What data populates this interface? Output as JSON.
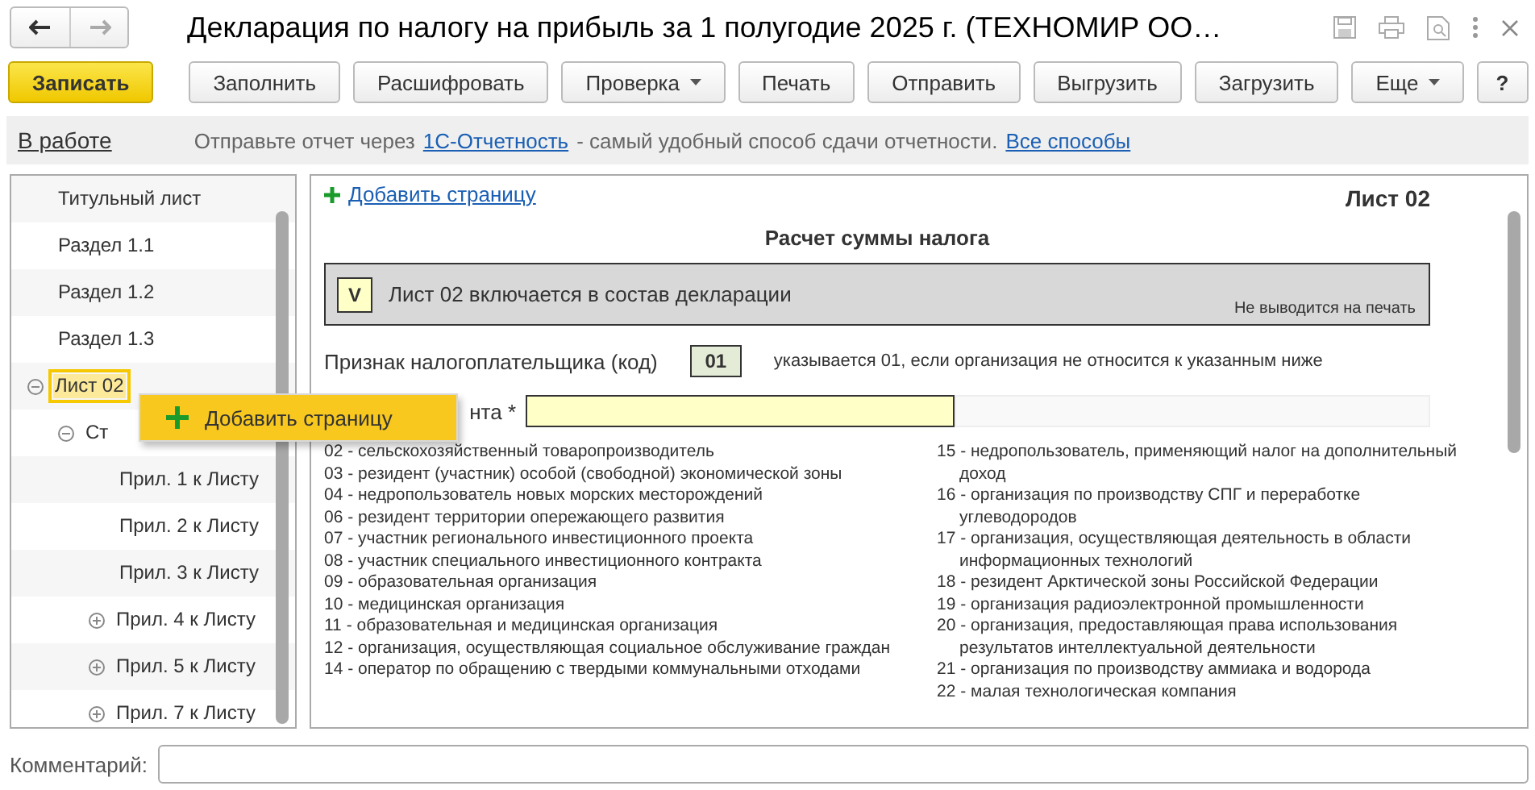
{
  "window": {
    "title": "Декларация по налогу на прибыль за 1 полугодие 2025 г. (ТЕХНОМИР ОО…"
  },
  "toolbar": [
    {
      "label": "Записать",
      "kind": "primary"
    },
    {
      "label": "Заполнить",
      "kind": "plain"
    },
    {
      "label": "Расшифровать",
      "kind": "plain"
    },
    {
      "label": "Проверка",
      "kind": "dropdown"
    },
    {
      "label": "Печать",
      "kind": "plain"
    },
    {
      "label": "Отправить",
      "kind": "plain"
    },
    {
      "label": "Выгрузить",
      "kind": "plain"
    },
    {
      "label": "Загрузить",
      "kind": "plain"
    },
    {
      "label": "Еще",
      "kind": "dropdown-right"
    },
    {
      "label": "?",
      "kind": "help"
    }
  ],
  "info_bar": {
    "status": "В работе",
    "text_before": "Отправьте отчет через",
    "link": "1С-Отчетность",
    "text_after": "- самый удобный способ сдачи отчетности.",
    "link_all": "Все способы"
  },
  "sidebar": {
    "items": [
      {
        "label": "Титульный лист",
        "selected": false
      },
      {
        "label": "Раздел 1.1",
        "selected": false
      },
      {
        "label": "Раздел 1.2",
        "selected": false
      },
      {
        "label": "Раздел 1.3",
        "selected": false
      },
      {
        "label": "Лист 02",
        "selected": true,
        "expanded": true,
        "children": [
          {
            "label": "Ст",
            "selected": false,
            "expanded": true,
            "children": [
              {
                "label": "Прил. 1 к Листу",
                "selected": false
              },
              {
                "label": "Прил. 2 к Листу",
                "selected": false
              },
              {
                "label": "Прил. 3 к Листу",
                "selected": false
              },
              {
                "label": "Прил. 4 к Листу",
                "selected": false,
                "expanded": false
              },
              {
                "label": "Прил. 5 к Листу",
                "selected": false,
                "expanded": false
              },
              {
                "label": "Прил. 7 к Листу",
                "selected": false,
                "expanded": false
              }
            ]
          }
        ]
      }
    ]
  },
  "context_menu": {
    "items": [
      {
        "label": "Добавить страницу"
      }
    ]
  },
  "sheet": {
    "add_page": "Добавить страницу",
    "sheet_name": "Лист 02",
    "heading": "Расчет суммы налога",
    "include": {
      "checked": true,
      "mark": "V",
      "text": "Лист 02 включается в состав декларации",
      "note": "Не выводится на печать"
    },
    "taxpayer": {
      "label": "Признак налогоплательщика (код)",
      "code": "01",
      "hint": "указывается 01, если организация не относится к указанным ниже"
    },
    "field_label": "нта *",
    "codes_left": [
      "02 - сельскохозяйственный товаропроизводитель",
      "03 - резидент (участник) особой (свободной) экономической зоны",
      "04 - недропользователь новых морских месторождений",
      "06 - резидент территории опережающего развития",
      "07 - участник регионального инвестиционного проекта",
      "08 - участник специального инвестиционного контракта",
      "09 - образовательная организация",
      "10 - медицинская организация",
      "11 - образовательная и медицинская организация",
      "12 - организация, осуществляющая социальное обслуживание граждан",
      "14 - оператор по обращению с твердыми коммунальными отходами"
    ],
    "codes_right": [
      "15 - недропользователь, применяющий налог на дополнительный доход",
      "16 - организация по производству СПГ и переработке углеводородов",
      "17 - организация, осуществляющая деятельность в области информационных технологий",
      "18 - резидент Арктической зоны Российской Федерации",
      "19 - организация радиоэлектронной промышленности",
      "20 - организация, предоставляющая права использования результатов интеллектуальной деятельности",
      "21 - организация по производству аммиака и водорода",
      "22 - малая технологическая компания"
    ]
  },
  "comment": {
    "label": "Комментарий:"
  }
}
